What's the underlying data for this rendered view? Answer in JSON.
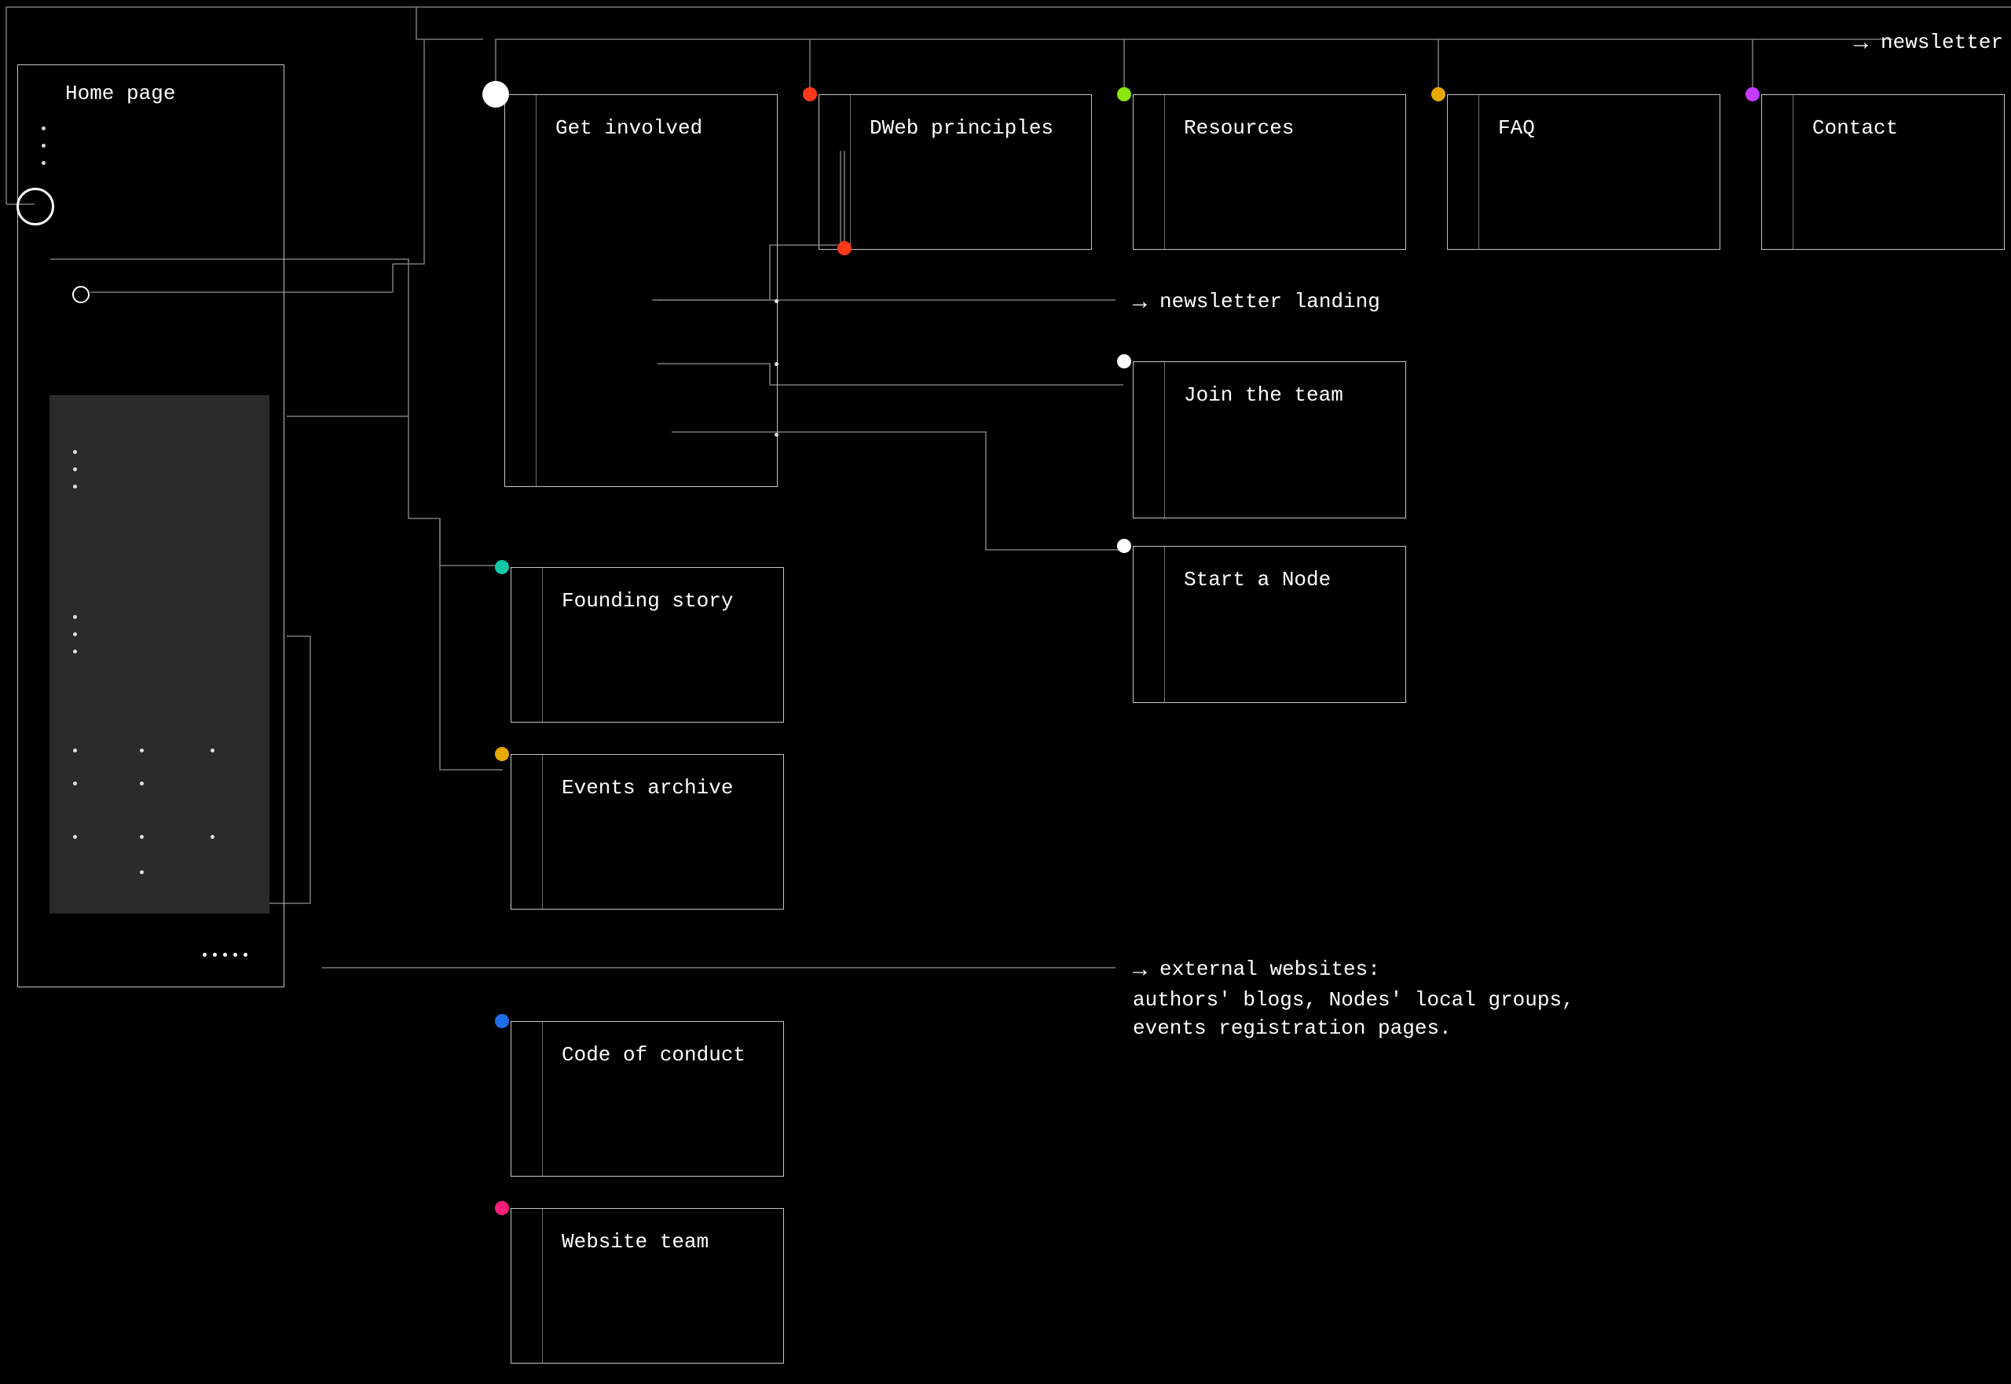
{
  "arrow": "→",
  "home": {
    "title": "Home page"
  },
  "nodes": {
    "get_involved": {
      "label": "Get involved"
    },
    "dweb_principles": {
      "label": "DWeb principles"
    },
    "resources": {
      "label": "Resources"
    },
    "faq": {
      "label": "FAQ"
    },
    "contact": {
      "label": "Contact"
    },
    "founding_story": {
      "label": "Founding story"
    },
    "events_archive": {
      "label": "Events archive"
    },
    "join_team": {
      "label": "Join the team"
    },
    "start_node": {
      "label": "Start a Node"
    },
    "code_conduct": {
      "label": "Code of conduct"
    },
    "website_team": {
      "label": "Website team"
    }
  },
  "labels": {
    "newsletter": "newsletter",
    "newsletter_landing": "newsletter landing",
    "external": "external websites:\nauthors' blogs, Nodes' local groups,\nevents registration pages."
  },
  "colors": {
    "get_involved": "#ffffff",
    "dweb_principles": "#ff3a1a",
    "resources": "#8be70a",
    "faq": "#e6a800",
    "contact": "#c33bff",
    "founding_story": "#11c7a5",
    "events_archive": "#e6a800",
    "join_team": "#ffffff",
    "start_node": "#ffffff",
    "code_conduct": "#1e6fe6",
    "website_team": "#ff1e7a"
  }
}
